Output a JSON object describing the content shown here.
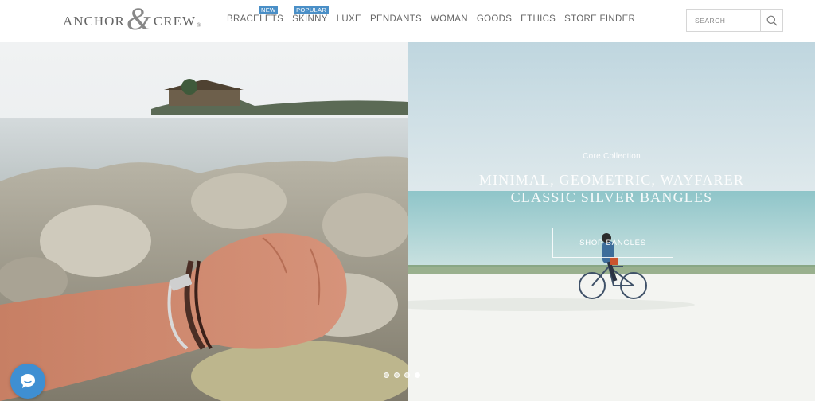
{
  "brand": {
    "left": "ANCHOR",
    "amp": "&",
    "right": "CREW",
    "reg": "®"
  },
  "nav": [
    {
      "label": "BRACELETS",
      "badge": "NEW"
    },
    {
      "label": "SKINNY",
      "badge": "POPULAR"
    },
    {
      "label": "LUXE"
    },
    {
      "label": "PENDANTS"
    },
    {
      "label": "WOMAN"
    },
    {
      "label": "GOODS"
    },
    {
      "label": "ETHICS"
    },
    {
      "label": "STORE FINDER"
    }
  ],
  "search": {
    "placeholder": "SEARCH",
    "icon": "search-icon"
  },
  "hero": {
    "eyebrow": "Core Collection",
    "headline_line1": "MINIMAL, GEOMETRIC, WAYFARER",
    "headline_line2": "CLASSIC SILVER BANGLES",
    "cta": "SHOP BANGLES"
  },
  "slider": {
    "count": 4,
    "active": 4
  },
  "chat": {
    "icon": "chat-icon"
  },
  "colors": {
    "badge": "#4a8fc7",
    "chat": "#3f8fd2",
    "nav_text": "#666666"
  }
}
